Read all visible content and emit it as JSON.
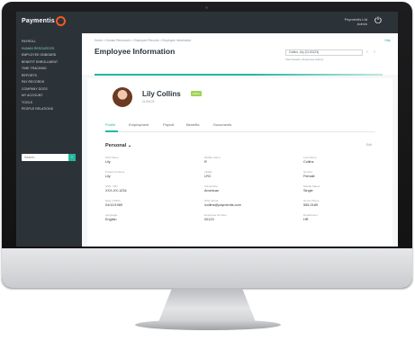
{
  "app": {
    "logo_text": "Paymentis",
    "user_name": "Paymentis Ltd",
    "user_sub": "Admin"
  },
  "sidebar": {
    "items": [
      {
        "label": "PAYROLL"
      },
      {
        "label": "HUMAN RESOURCES"
      },
      {
        "label": "EMPLOYEE ONBOARD"
      },
      {
        "label": "BENEFIT ENROLLMENT"
      },
      {
        "label": "TIME TRACKING"
      },
      {
        "label": "REPORTS"
      },
      {
        "label": "PAY RECORDS"
      },
      {
        "label": "COMPANY DOCS"
      },
      {
        "label": "MY ACCOUNT"
      },
      {
        "label": "TOOLS"
      },
      {
        "label": "PEOPLE RELATIONS"
      }
    ],
    "search_placeholder": "Search..."
  },
  "header": {
    "breadcrumb": "Home > Human Resources > Employee Records > Employee Information",
    "help": "Help",
    "title": "Employee Information",
    "employee_select": "Collins, Lily (CL00123)",
    "employee_links": "View Details | Employee History"
  },
  "employee": {
    "name": "Lily Collins",
    "status": "Active",
    "sub": "CL00123"
  },
  "tabs": [
    {
      "label": "Profile"
    },
    {
      "label": "Employment"
    },
    {
      "label": "Payroll"
    },
    {
      "label": "Benefits"
    },
    {
      "label": "Documents"
    }
  ],
  "section": {
    "title": "Personal",
    "edit": "Edit"
  },
  "fields": [
    {
      "label": "First Name",
      "value": "Lily"
    },
    {
      "label": "Middle Name",
      "value": "R"
    },
    {
      "label": "Last Name",
      "value": "Collins"
    },
    {
      "label": "Preferred Name",
      "value": "Lily"
    },
    {
      "label": "Initials",
      "value": "LRC"
    },
    {
      "label": "Gender",
      "value": "Female"
    },
    {
      "label": "SSN / SIN",
      "value": "XXX-XX-1234"
    },
    {
      "label": "Citizenship",
      "value": "American"
    },
    {
      "label": "Marital Status",
      "value": "Single"
    },
    {
      "label": "Date of Birth",
      "value": "04/12/1989"
    },
    {
      "label": "Work Email",
      "value": "lcollins@paymentis.com"
    },
    {
      "label": "Home Phone",
      "value": "555-0189"
    },
    {
      "label": "Language",
      "value": "English"
    },
    {
      "label": "Employee Number",
      "value": "00123"
    },
    {
      "label": "Department",
      "value": "HR"
    }
  ],
  "colors": {
    "accent": "#23b89f",
    "sidebar": "#2c3338",
    "logo_ring": "#f05a28",
    "status": "#9fd356"
  }
}
